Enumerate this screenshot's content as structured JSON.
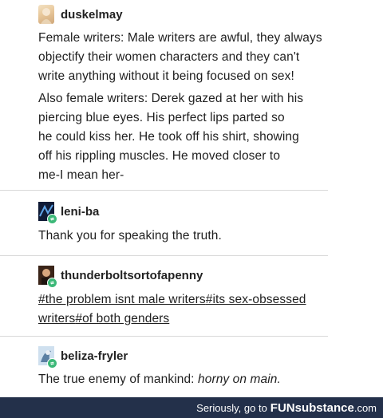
{
  "posts": [
    {
      "username": "duskelmay",
      "lines": [
        "Female writers: Male writers are awful, they always",
        "objectify their women characters and they can't",
        "write anything without it being focused on sex!"
      ],
      "lines2": [
        "Also female writers: Derek gazed at her with his",
        "piercing blue eyes. His perfect lips parted so",
        "he could kiss her. He took off his shirt, showing",
        "off his rippling muscles. He moved closer to",
        "me-I mean her-"
      ]
    },
    {
      "username": "leni-ba",
      "text": "Thank you for speaking the truth."
    },
    {
      "username": "thunderboltsortofapenny",
      "tags": [
        "#the problem isnt male writers",
        "#its sex-obsessed",
        "writers",
        "#of both genders"
      ]
    },
    {
      "username": "beliza-fryler",
      "text_plain": "The true enemy of mankind: ",
      "text_italic": "horny on main."
    }
  ],
  "footer": {
    "text": "Seriously, go to",
    "brand": "FUNsubstance",
    "ext": ".com"
  },
  "colors": {
    "reblog_badge": "#3cb878",
    "footer_bg": "#23304a"
  },
  "icons": [
    "reblog-icon"
  ]
}
